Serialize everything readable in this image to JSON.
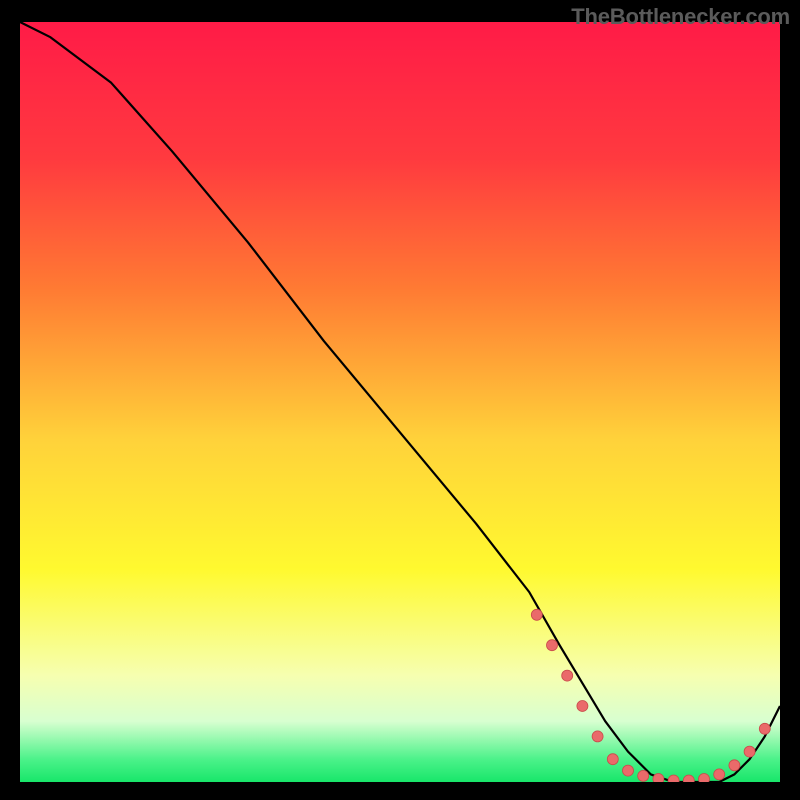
{
  "watermark": "TheBottlenecker.com",
  "colors": {
    "gradient_stops": [
      {
        "offset": 0.0,
        "color": "#ff1b47"
      },
      {
        "offset": 0.18,
        "color": "#ff3a3f"
      },
      {
        "offset": 0.35,
        "color": "#ff7a33"
      },
      {
        "offset": 0.55,
        "color": "#ffd23a"
      },
      {
        "offset": 0.72,
        "color": "#fff92f"
      },
      {
        "offset": 0.86,
        "color": "#f6ffb0"
      },
      {
        "offset": 0.92,
        "color": "#d8ffd0"
      },
      {
        "offset": 0.97,
        "color": "#4cf28a"
      },
      {
        "offset": 1.0,
        "color": "#18e66a"
      }
    ],
    "curve_stroke": "#000000",
    "marker_fill": "#ea6a6a",
    "marker_stroke": "#c94b4b",
    "frame_bg": "#000000"
  },
  "chart_data": {
    "type": "line",
    "title": "",
    "xlabel": "",
    "ylabel": "",
    "xlim": [
      0,
      100
    ],
    "ylim": [
      0,
      100
    ],
    "series": [
      {
        "name": "bottleneck-curve",
        "x": [
          0,
          4,
          8,
          12,
          20,
          30,
          40,
          50,
          60,
          67,
          71,
          74,
          77,
          80,
          83,
          86,
          89,
          92,
          94,
          96,
          98,
          100
        ],
        "y": [
          100,
          98,
          95,
          92,
          83,
          71,
          58,
          46,
          34,
          25,
          18,
          13,
          8,
          4,
          1,
          0,
          0,
          0,
          1,
          3,
          6,
          10
        ]
      }
    ],
    "markers": {
      "name": "highlighted-points",
      "points": [
        {
          "x": 68,
          "y": 22
        },
        {
          "x": 70,
          "y": 18
        },
        {
          "x": 72,
          "y": 14
        },
        {
          "x": 74,
          "y": 10
        },
        {
          "x": 76,
          "y": 6
        },
        {
          "x": 78,
          "y": 3
        },
        {
          "x": 80,
          "y": 1.5
        },
        {
          "x": 82,
          "y": 0.8
        },
        {
          "x": 84,
          "y": 0.4
        },
        {
          "x": 86,
          "y": 0.2
        },
        {
          "x": 88,
          "y": 0.2
        },
        {
          "x": 90,
          "y": 0.4
        },
        {
          "x": 92,
          "y": 1.0
        },
        {
          "x": 94,
          "y": 2.2
        },
        {
          "x": 96,
          "y": 4.0
        },
        {
          "x": 98,
          "y": 7.0
        }
      ]
    }
  }
}
